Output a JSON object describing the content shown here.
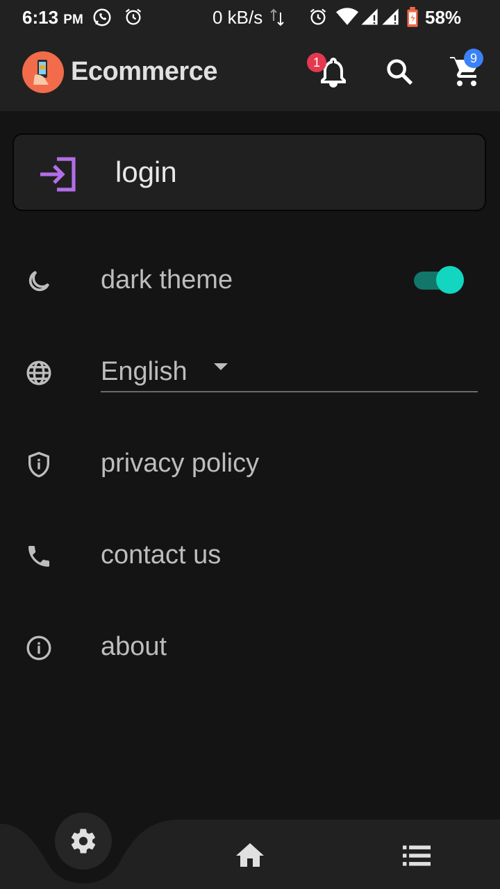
{
  "status_bar": {
    "time": "6:13",
    "ampm": "PM",
    "net_speed": "0 kB/s",
    "battery_percent": "58%"
  },
  "app_bar": {
    "title": "Ecommerce",
    "notifications_badge": "1",
    "cart_badge": "9"
  },
  "login": {
    "label": "login"
  },
  "settings": {
    "dark_theme": {
      "label": "dark theme",
      "enabled": true
    },
    "language": {
      "selected": "English"
    },
    "privacy": {
      "label": "privacy policy"
    },
    "contact": {
      "label": "contact us"
    },
    "about": {
      "label": "about"
    }
  },
  "colors": {
    "background": "#141414",
    "app_bar": "#212121",
    "accent_login": "#b26ee8",
    "toggle_thumb": "#12d6bf",
    "badge_red": "#e53950",
    "badge_blue": "#3b82f6"
  },
  "icons": {
    "status": [
      "whatsapp-icon",
      "alarm-icon",
      "wifi-icon",
      "signal-icon",
      "battery-icon"
    ],
    "app_bar": [
      "app-logo",
      "bell-icon",
      "search-icon",
      "cart-icon"
    ],
    "rows": [
      "moon-icon",
      "globe-icon",
      "shield-icon",
      "phone-icon",
      "info-icon"
    ],
    "bottom_nav": [
      "gear-icon",
      "home-icon",
      "list-icon"
    ]
  }
}
